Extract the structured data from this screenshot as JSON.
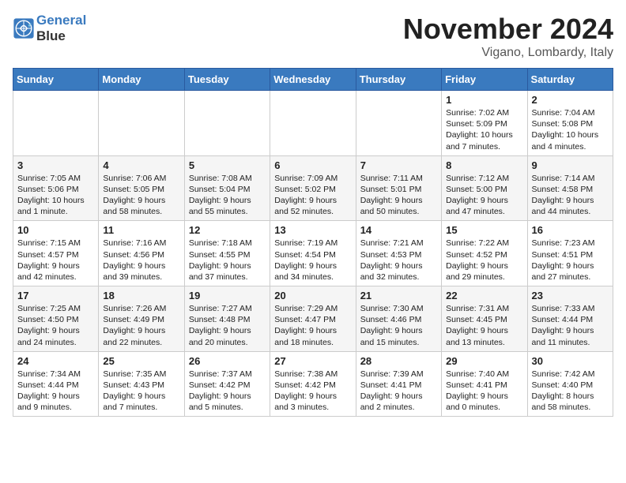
{
  "header": {
    "logo_line1": "General",
    "logo_line2": "Blue",
    "month": "November 2024",
    "location": "Vigano, Lombardy, Italy"
  },
  "weekdays": [
    "Sunday",
    "Monday",
    "Tuesday",
    "Wednesday",
    "Thursday",
    "Friday",
    "Saturday"
  ],
  "weeks": [
    [
      {
        "day": "",
        "info": ""
      },
      {
        "day": "",
        "info": ""
      },
      {
        "day": "",
        "info": ""
      },
      {
        "day": "",
        "info": ""
      },
      {
        "day": "",
        "info": ""
      },
      {
        "day": "1",
        "info": "Sunrise: 7:02 AM\nSunset: 5:09 PM\nDaylight: 10 hours and 7 minutes."
      },
      {
        "day": "2",
        "info": "Sunrise: 7:04 AM\nSunset: 5:08 PM\nDaylight: 10 hours and 4 minutes."
      }
    ],
    [
      {
        "day": "3",
        "info": "Sunrise: 7:05 AM\nSunset: 5:06 PM\nDaylight: 10 hours and 1 minute."
      },
      {
        "day": "4",
        "info": "Sunrise: 7:06 AM\nSunset: 5:05 PM\nDaylight: 9 hours and 58 minutes."
      },
      {
        "day": "5",
        "info": "Sunrise: 7:08 AM\nSunset: 5:04 PM\nDaylight: 9 hours and 55 minutes."
      },
      {
        "day": "6",
        "info": "Sunrise: 7:09 AM\nSunset: 5:02 PM\nDaylight: 9 hours and 52 minutes."
      },
      {
        "day": "7",
        "info": "Sunrise: 7:11 AM\nSunset: 5:01 PM\nDaylight: 9 hours and 50 minutes."
      },
      {
        "day": "8",
        "info": "Sunrise: 7:12 AM\nSunset: 5:00 PM\nDaylight: 9 hours and 47 minutes."
      },
      {
        "day": "9",
        "info": "Sunrise: 7:14 AM\nSunset: 4:58 PM\nDaylight: 9 hours and 44 minutes."
      }
    ],
    [
      {
        "day": "10",
        "info": "Sunrise: 7:15 AM\nSunset: 4:57 PM\nDaylight: 9 hours and 42 minutes."
      },
      {
        "day": "11",
        "info": "Sunrise: 7:16 AM\nSunset: 4:56 PM\nDaylight: 9 hours and 39 minutes."
      },
      {
        "day": "12",
        "info": "Sunrise: 7:18 AM\nSunset: 4:55 PM\nDaylight: 9 hours and 37 minutes."
      },
      {
        "day": "13",
        "info": "Sunrise: 7:19 AM\nSunset: 4:54 PM\nDaylight: 9 hours and 34 minutes."
      },
      {
        "day": "14",
        "info": "Sunrise: 7:21 AM\nSunset: 4:53 PM\nDaylight: 9 hours and 32 minutes."
      },
      {
        "day": "15",
        "info": "Sunrise: 7:22 AM\nSunset: 4:52 PM\nDaylight: 9 hours and 29 minutes."
      },
      {
        "day": "16",
        "info": "Sunrise: 7:23 AM\nSunset: 4:51 PM\nDaylight: 9 hours and 27 minutes."
      }
    ],
    [
      {
        "day": "17",
        "info": "Sunrise: 7:25 AM\nSunset: 4:50 PM\nDaylight: 9 hours and 24 minutes."
      },
      {
        "day": "18",
        "info": "Sunrise: 7:26 AM\nSunset: 4:49 PM\nDaylight: 9 hours and 22 minutes."
      },
      {
        "day": "19",
        "info": "Sunrise: 7:27 AM\nSunset: 4:48 PM\nDaylight: 9 hours and 20 minutes."
      },
      {
        "day": "20",
        "info": "Sunrise: 7:29 AM\nSunset: 4:47 PM\nDaylight: 9 hours and 18 minutes."
      },
      {
        "day": "21",
        "info": "Sunrise: 7:30 AM\nSunset: 4:46 PM\nDaylight: 9 hours and 15 minutes."
      },
      {
        "day": "22",
        "info": "Sunrise: 7:31 AM\nSunset: 4:45 PM\nDaylight: 9 hours and 13 minutes."
      },
      {
        "day": "23",
        "info": "Sunrise: 7:33 AM\nSunset: 4:44 PM\nDaylight: 9 hours and 11 minutes."
      }
    ],
    [
      {
        "day": "24",
        "info": "Sunrise: 7:34 AM\nSunset: 4:44 PM\nDaylight: 9 hours and 9 minutes."
      },
      {
        "day": "25",
        "info": "Sunrise: 7:35 AM\nSunset: 4:43 PM\nDaylight: 9 hours and 7 minutes."
      },
      {
        "day": "26",
        "info": "Sunrise: 7:37 AM\nSunset: 4:42 PM\nDaylight: 9 hours and 5 minutes."
      },
      {
        "day": "27",
        "info": "Sunrise: 7:38 AM\nSunset: 4:42 PM\nDaylight: 9 hours and 3 minutes."
      },
      {
        "day": "28",
        "info": "Sunrise: 7:39 AM\nSunset: 4:41 PM\nDaylight: 9 hours and 2 minutes."
      },
      {
        "day": "29",
        "info": "Sunrise: 7:40 AM\nSunset: 4:41 PM\nDaylight: 9 hours and 0 minutes."
      },
      {
        "day": "30",
        "info": "Sunrise: 7:42 AM\nSunset: 4:40 PM\nDaylight: 8 hours and 58 minutes."
      }
    ]
  ]
}
